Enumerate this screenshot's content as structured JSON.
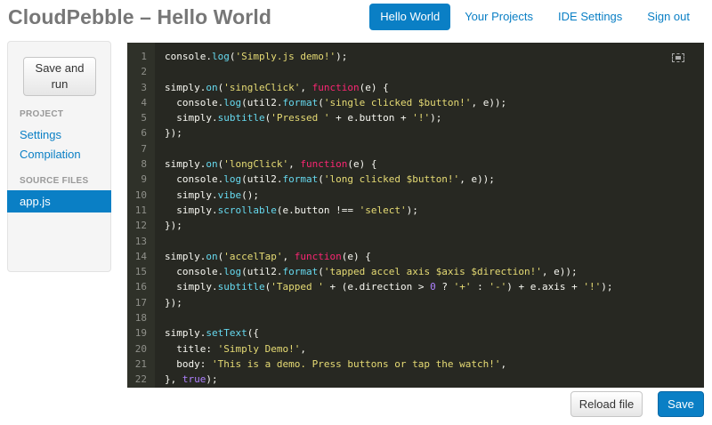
{
  "app": {
    "title": "CloudPebble – Hello World"
  },
  "nav": {
    "items": [
      {
        "label": "Hello World",
        "active": true
      },
      {
        "label": "Your Projects"
      },
      {
        "label": "IDE Settings"
      },
      {
        "label": "Sign out"
      }
    ]
  },
  "sidebar": {
    "run_button": "Save and\nrun",
    "project_heading": "PROJECT",
    "project_links": [
      "Settings",
      "Compilation"
    ],
    "source_heading": "SOURCE FILES",
    "files": [
      {
        "label": "app.js",
        "selected": true
      }
    ]
  },
  "editor": {
    "icon": "fullscreen-icon",
    "lines": [
      "console.log('Simply.js demo!');",
      "",
      "simply.on('singleClick', function(e) {",
      "  console.log(util2.format('single clicked $button!', e));",
      "  simply.subtitle('Pressed ' + e.button + '!');",
      "});",
      "",
      "simply.on('longClick', function(e) {",
      "  console.log(util2.format('long clicked $button!', e));",
      "  simply.vibe();",
      "  simply.scrollable(e.button !== 'select');",
      "});",
      "",
      "simply.on('accelTap', function(e) {",
      "  console.log(util2.format('tapped accel axis $axis $direction!', e));",
      "  simply.subtitle('Tapped ' + (e.direction > 0 ? '+' : '-') + e.axis + '!');",
      "});",
      "",
      "simply.setText({",
      "  title: 'Simply Demo!',",
      "  body: 'This is a demo. Press buttons or tap the watch!',",
      "}, true);",
      "",
      ""
    ]
  },
  "footer": {
    "reload_label": "Reload file",
    "save_label": "Save"
  },
  "colors": {
    "accent": "#0a7fc5",
    "editor_bg": "#272822",
    "gutter_bg": "#2f3129",
    "keyword": "#f92672",
    "function": "#66d9ef",
    "string": "#e6db74",
    "number": "#ae81ff",
    "text": "#f8f8f2"
  }
}
